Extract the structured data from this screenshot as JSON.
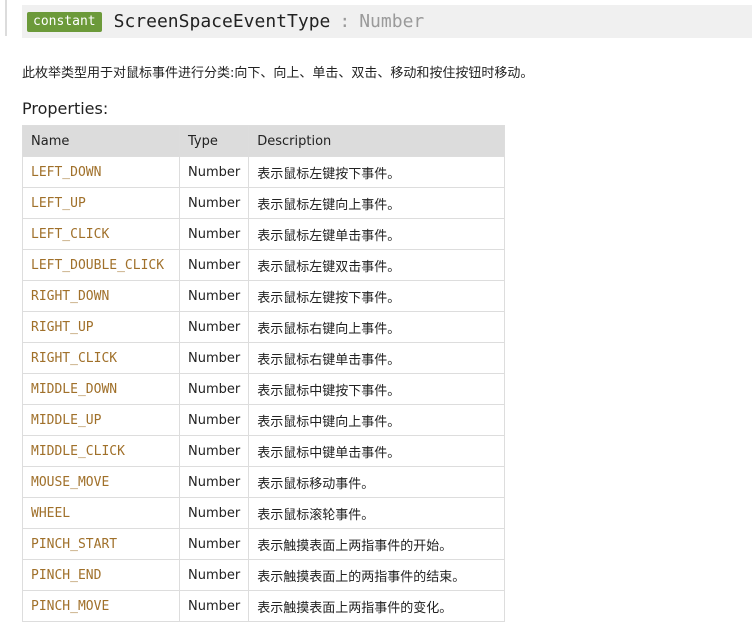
{
  "header": {
    "badge": "constant",
    "name": "ScreenSpaceEventType",
    "separator": ":",
    "type": "Number"
  },
  "description": "此枚举类型用于对鼠标事件进行分类:向下、向上、单击、双击、移动和按住按钮时移动。",
  "properties_heading": "Properties:",
  "table": {
    "columns": [
      "Name",
      "Type",
      "Description"
    ],
    "rows": [
      {
        "name": "LEFT_DOWN",
        "type": "Number",
        "description": "表示鼠标左键按下事件。"
      },
      {
        "name": "LEFT_UP",
        "type": "Number",
        "description": "表示鼠标左键向上事件。"
      },
      {
        "name": "LEFT_CLICK",
        "type": "Number",
        "description": "表示鼠标左键单击事件。"
      },
      {
        "name": "LEFT_DOUBLE_CLICK",
        "type": "Number",
        "description": "表示鼠标左键双击事件。"
      },
      {
        "name": "RIGHT_DOWN",
        "type": "Number",
        "description": "表示鼠标左键按下事件。"
      },
      {
        "name": "RIGHT_UP",
        "type": "Number",
        "description": "表示鼠标右键向上事件。"
      },
      {
        "name": "RIGHT_CLICK",
        "type": "Number",
        "description": "表示鼠标右键单击事件。"
      },
      {
        "name": "MIDDLE_DOWN",
        "type": "Number",
        "description": "表示鼠标中键按下事件。"
      },
      {
        "name": "MIDDLE_UP",
        "type": "Number",
        "description": "表示鼠标中键向上事件。"
      },
      {
        "name": "MIDDLE_CLICK",
        "type": "Number",
        "description": "表示鼠标中键单击事件。"
      },
      {
        "name": "MOUSE_MOVE",
        "type": "Number",
        "description": "表示鼠标移动事件。"
      },
      {
        "name": "WHEEL",
        "type": "Number",
        "description": "表示鼠标滚轮事件。"
      },
      {
        "name": "PINCH_START",
        "type": "Number",
        "description": "表示触摸表面上两指事件的开始。"
      },
      {
        "name": "PINCH_END",
        "type": "Number",
        "description": "表示触摸表面上的两指事件的结束。"
      },
      {
        "name": "PINCH_MOVE",
        "type": "Number",
        "description": "表示触摸表面上两指事件的变化。"
      }
    ]
  }
}
